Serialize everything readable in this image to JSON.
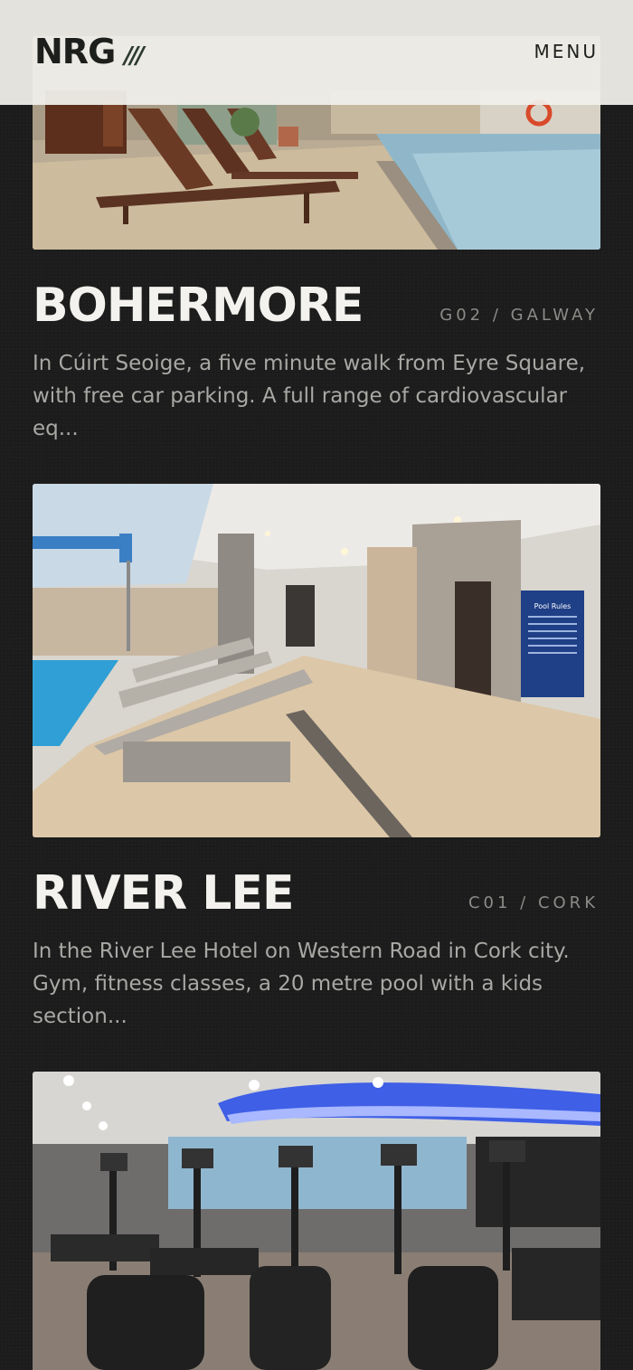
{
  "header": {
    "logo": "NRG",
    "logo_mark": "///",
    "menu_label": "MENU"
  },
  "clubs": [
    {
      "name": "BOHERMORE",
      "code": "G02 / GALWAY",
      "description": "In Cúirt Seoige, a five minute walk from Eyre Square, with free car parking. A full range of cardiovascular eq...",
      "image": "pool-loungers-photo"
    },
    {
      "name": "RIVER LEE",
      "code": "C01 / CORK",
      "description": "In the River Lee Hotel on Western Road in Cork city. Gym, fitness classes, a 20 metre pool with a kids section...",
      "image": "pool-spa-photo",
      "sign_text": "Pool Rules"
    },
    {
      "name": "",
      "code": "",
      "description": "",
      "image": "gym-cardio-photo"
    }
  ]
}
